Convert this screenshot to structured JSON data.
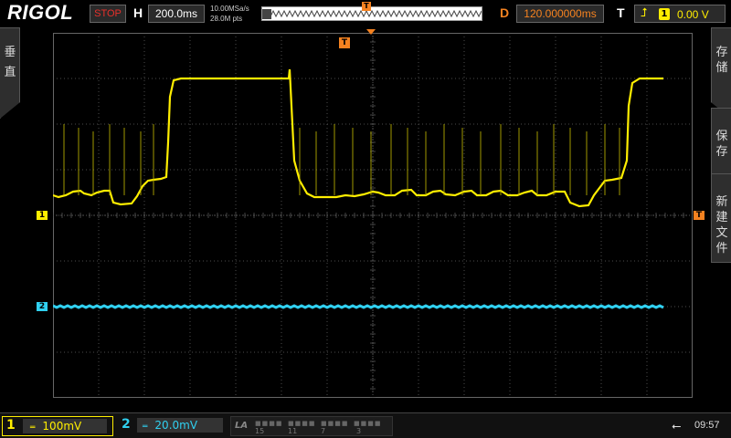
{
  "header": {
    "brand": "RIGOL",
    "run_state": "STOP",
    "horizontal_label": "H",
    "timebase": "200.0ms",
    "sample_rate": "10.00MSa/s",
    "memory_depth": "28.0M pts",
    "trigger_position_marker": "T",
    "delay_label": "D",
    "delay_value": "120.000000ms",
    "trigger_label": "T",
    "trigger_source": "1",
    "trigger_level": "0.00 V",
    "trigger_edge_icon": "rising-edge-icon"
  },
  "side_left": {
    "vertical_label": [
      "垂",
      "直"
    ]
  },
  "side_right": {
    "tabs": [
      {
        "chars": [
          "存",
          "储"
        ]
      },
      {
        "chars": [
          "保",
          "存"
        ]
      },
      {
        "chars": [
          "新",
          "建",
          "文",
          "件"
        ]
      }
    ]
  },
  "markers": {
    "ch1": "1",
    "ch2": "2",
    "trigger_top": "T",
    "trigger_level": "T"
  },
  "footer": {
    "ch1": {
      "number": "1",
      "coupling_icon": "dc-coupling-icon",
      "coupling_symbol": "═",
      "scale": "100mV"
    },
    "ch2": {
      "number": "2",
      "coupling_icon": "dc-coupling-icon",
      "coupling_symbol": "═",
      "scale": "20.0mV"
    },
    "la": {
      "label": "LA",
      "groups": [
        "15",
        "11",
        "7",
        "3"
      ]
    },
    "usb_icon": "usb-icon",
    "time": "09:57"
  },
  "colors": {
    "ch1": "#ffee00",
    "ch2": "#30d0f0",
    "trigger": "#f58220",
    "run_state": "#e8302a",
    "grid": "#555555",
    "background": "#000000"
  }
}
